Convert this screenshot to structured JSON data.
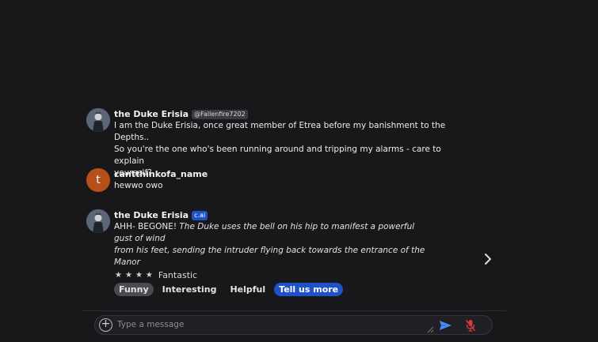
{
  "messages": [
    {
      "author": "the Duke Erisia",
      "handle": "@Fallenfire7202",
      "text_lines": [
        "I am the Duke Erisia, once great member of Etrea before my banishment to the Depths..",
        "So you're the one who's been running around and tripping my alarms - care to explain",
        "yourself?"
      ]
    },
    {
      "author": "cantthinkofa_name",
      "avatar_letter": "t",
      "text_lines": [
        "hewwo owo"
      ]
    },
    {
      "author": "the Duke Erisia",
      "badge": "c.ai",
      "lead": "AHH- BEGONE! ",
      "action_line1": "The Duke uses the bell on his hip to manifest a powerful gust of wind",
      "action_line2": "from his feet, sending the intruder flying back towards the entrance of the Manor"
    }
  ],
  "rating": {
    "stars": 4,
    "label": "Fantastic"
  },
  "feedback_chips": [
    "Funny",
    "Interesting",
    "Helpful",
    "Tell us more"
  ],
  "input": {
    "placeholder": "Type a message"
  },
  "icons": {
    "next": "chevron-right-icon",
    "add": "plus-circle-icon",
    "send": "send-icon",
    "mic": "mic-off-icon"
  },
  "colors": {
    "accent": "#1f52c9",
    "mic_muted": "#d63a3a",
    "avatar_user": "#b5501a"
  }
}
